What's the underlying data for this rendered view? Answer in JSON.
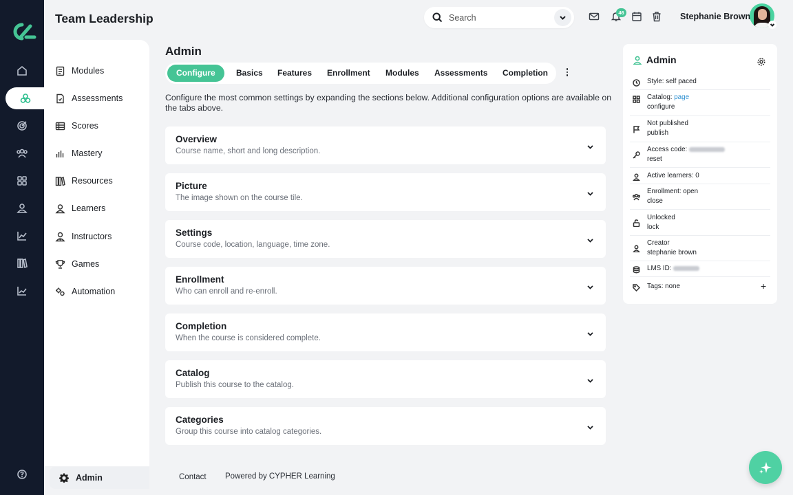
{
  "app": {
    "title": "Team Leadership"
  },
  "header": {
    "search_placeholder": "Search",
    "notification_count": "46",
    "user_name": "Stephanie Brown"
  },
  "rail": {
    "items": [
      "home-icon",
      "course-icon",
      "target-icon",
      "people-icon",
      "apps-icon",
      "person-icon",
      "analytics-icon",
      "library-icon",
      "chart-icon"
    ],
    "active": "course-icon",
    "help": "help-icon"
  },
  "sidebar": {
    "items": [
      {
        "label": "Modules",
        "icon": "modules-icon"
      },
      {
        "label": "Assessments",
        "icon": "assessments-icon"
      },
      {
        "label": "Scores",
        "icon": "scores-icon"
      },
      {
        "label": "Mastery",
        "icon": "mastery-icon"
      },
      {
        "label": "Resources",
        "icon": "resources-icon"
      },
      {
        "label": "Learners",
        "icon": "learners-icon"
      },
      {
        "label": "Instructors",
        "icon": "instructors-icon"
      },
      {
        "label": "Games",
        "icon": "games-icon"
      },
      {
        "label": "Automation",
        "icon": "automation-icon"
      }
    ],
    "admin_label": "Admin"
  },
  "main": {
    "title": "Admin",
    "tabs": [
      "Configure",
      "Basics",
      "Features",
      "Enrollment",
      "Modules",
      "Assessments",
      "Completion"
    ],
    "active_tab": "Configure",
    "intro": "Configure the most common settings by expanding the sections below. Additional configuration options are available on the tabs above.",
    "sections": [
      {
        "title": "Overview",
        "desc": "Course name, short and long description."
      },
      {
        "title": "Picture",
        "desc": "The image shown on the course tile."
      },
      {
        "title": "Settings",
        "desc": "Course code, location, language, time zone."
      },
      {
        "title": "Enrollment",
        "desc": "Who can enroll and re-enroll."
      },
      {
        "title": "Completion",
        "desc": "When the course is considered complete."
      },
      {
        "title": "Catalog",
        "desc": "Publish this course to the catalog."
      },
      {
        "title": "Categories",
        "desc": "Group this course into catalog categories."
      }
    ]
  },
  "footer": {
    "contact": "Contact",
    "powered": "Powered by CYPHER Learning"
  },
  "panel": {
    "title": "Admin",
    "style": "Style: self paced",
    "catalog_label": "Catalog:",
    "catalog_link": "page",
    "catalog_action": "configure",
    "publish_status": "Not published",
    "publish_action": "publish",
    "access_label": "Access code:",
    "access_action": "reset",
    "active_learners": "Active learners: 0",
    "enrollment_status": "Enrollment: open",
    "enrollment_action": "close",
    "lock_status": "Unlocked",
    "lock_action": "lock",
    "creator_label": "Creator",
    "creator_name": "stephanie brown",
    "lms_label": "LMS ID:",
    "tags": "Tags: none"
  },
  "colors": {
    "accent": "#45c495",
    "rail": "#121a2b",
    "link": "#2d8fd0"
  }
}
